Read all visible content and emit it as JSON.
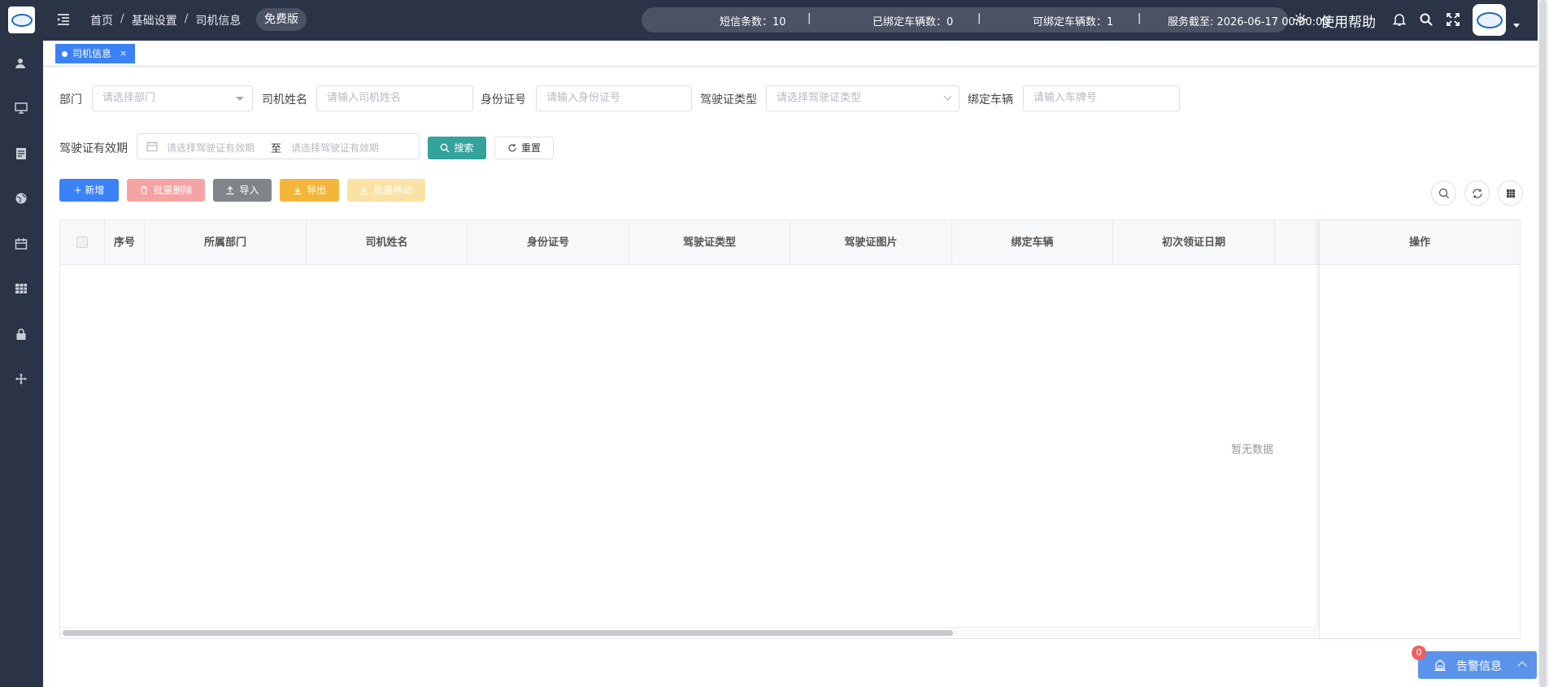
{
  "topbar": {
    "breadcrumb": [
      "首页",
      "基础设置",
      "司机信息"
    ],
    "breadcrumb_sep": "/",
    "badge": "免费版",
    "stats": {
      "sms": "短信条数：10",
      "bound": "已绑定车辆数：0",
      "bindable": "可绑定车辆数：1",
      "service": "服务截至: 2026-06-17 00:00:00"
    },
    "stat_sep": "|",
    "help": "使用帮助"
  },
  "sidebar": {
    "items": [
      "user-icon",
      "monitor-icon",
      "report-icon",
      "globe-icon",
      "calendar-icon",
      "grid-icon",
      "lock-icon",
      "move-icon"
    ]
  },
  "tabs": [
    {
      "label": "司机信息",
      "close": "×"
    }
  ],
  "filters": {
    "dept_label": "部门",
    "dept_placeholder": "请选择部门",
    "driver_label": "司机姓名",
    "driver_placeholder": "请输入司机姓名",
    "id_label": "身份证号",
    "id_placeholder": "请输入身份证号",
    "lic_type_label": "驾驶证类型",
    "lic_type_placeholder": "请选择驾驶证类型",
    "vehicle_label": "绑定车辆",
    "vehicle_placeholder": "请输入车牌号",
    "valid_label": "驾驶证有效期",
    "valid_start_placeholder": "请选择驾驶证有效期",
    "valid_to": "至",
    "valid_end_placeholder": "请选择驾驶证有效期",
    "search": "搜索",
    "reset": "重置"
  },
  "toolbar": {
    "add": "+ 新增",
    "batch_delete": "批量删除",
    "import": "导入",
    "export": "导出",
    "batch_move": "批量移动"
  },
  "table": {
    "columns": [
      "序号",
      "所属部门",
      "司机姓名",
      "身份证号",
      "驾驶证类型",
      "驾驶证图片",
      "绑定车辆",
      "初次领证日期",
      "操作"
    ],
    "empty": "暂无数据"
  },
  "alert": {
    "label": "告警信息",
    "count": "0"
  },
  "colors": {
    "nav_bg": "#2b3447",
    "primary": "#3b82f6",
    "teal": "#33a39b",
    "danger_light": "#f5a3a3",
    "warning": "#f4b63a"
  }
}
